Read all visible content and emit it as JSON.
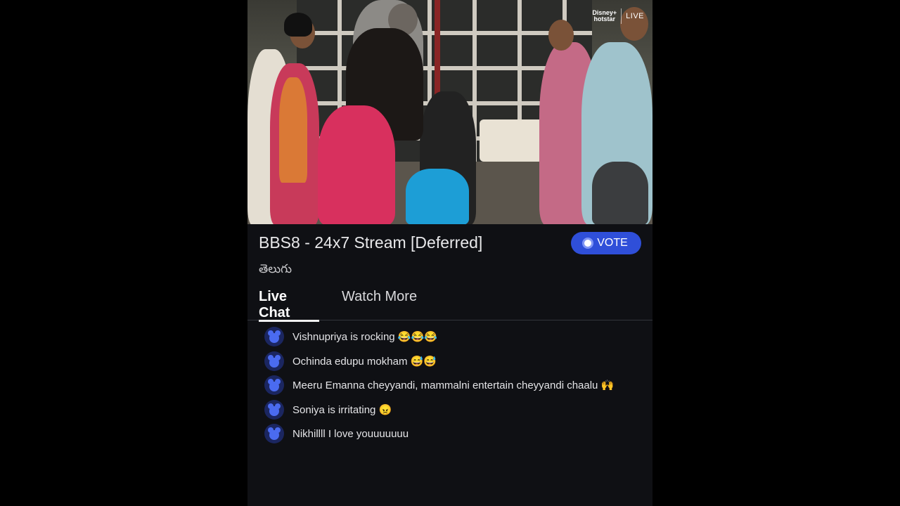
{
  "brand": {
    "logo_line1": "Disney+",
    "logo_line2": "hotstar",
    "live_label": "LIVE"
  },
  "stream": {
    "title": "BBS8 - 24x7 Stream [Deferred]",
    "language": "తెలుగు"
  },
  "vote_button": {
    "label": "VOTE",
    "accent": "#2f4fd9"
  },
  "tabs": [
    {
      "label": "Live Chat",
      "active": true
    },
    {
      "label": "Watch More",
      "active": false
    }
  ],
  "chat": {
    "messages": [
      {
        "avatar": "mickey-avatar-icon",
        "text": "Vishnupriya is rocking 😂😂😂"
      },
      {
        "avatar": "mickey-avatar-icon",
        "text": "Ochinda edupu mokham 😅😅"
      },
      {
        "avatar": "mickey-avatar-icon",
        "text": "Meeru Emanna cheyyandi, mammalni entertain cheyyandi chaalu 🙌"
      },
      {
        "avatar": "mickey-avatar-icon",
        "text": "Soniya is irritating 😠"
      },
      {
        "avatar": "mickey-avatar-icon",
        "text": "Nikhillll I love youuuuuuu"
      }
    ]
  }
}
